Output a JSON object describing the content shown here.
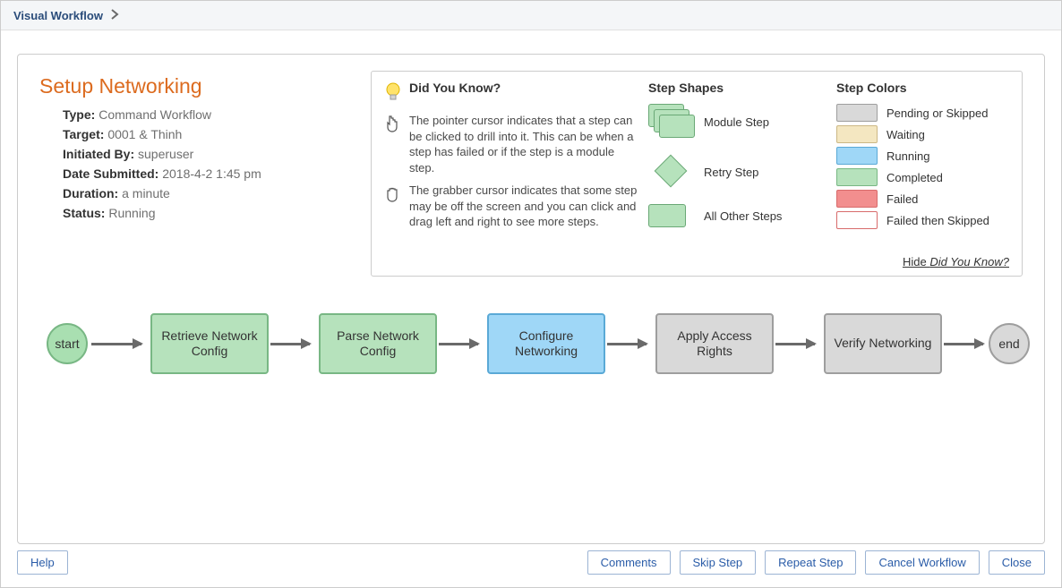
{
  "header": {
    "breadcrumb": "Visual Workflow"
  },
  "workflow": {
    "title": "Setup Networking",
    "meta": {
      "type_label": "Type:",
      "type_value": "Command Workflow",
      "target_label": "Target:",
      "target_value": "0001 & Thinh",
      "initiated_label": "Initiated By:",
      "initiated_value": "superuser",
      "submitted_label": "Date Submitted:",
      "submitted_value": "2018-4-2 1:45 pm",
      "duration_label": "Duration:",
      "duration_value": "a minute",
      "status_label": "Status:",
      "status_value": "Running"
    }
  },
  "didyouknow": {
    "heading": "Did You Know?",
    "tips": [
      "The pointer cursor indicates that a step can be clicked to drill into it. This can be when a step has failed or if the step is a module step.",
      "The grabber cursor indicates that some step may be off the screen and you can click and drag left and right to see more steps."
    ],
    "hide_label_prefix": "Hide ",
    "hide_label_em": "Did You Know?"
  },
  "shapes": {
    "heading": "Step Shapes",
    "items": [
      {
        "label": "Module Step"
      },
      {
        "label": "Retry Step"
      },
      {
        "label": "All Other Steps"
      }
    ]
  },
  "colors": {
    "heading": "Step Colors",
    "items": [
      {
        "label": "Pending or Skipped",
        "hex": "#d9d9d9",
        "border": "#9e9e9e"
      },
      {
        "label": "Waiting",
        "hex": "#f4e7c1",
        "border": "#ccb885"
      },
      {
        "label": "Running",
        "hex": "#9fd7f7",
        "border": "#5aa9d6"
      },
      {
        "label": "Completed",
        "hex": "#b6e2bc",
        "border": "#78b784"
      },
      {
        "label": "Failed",
        "hex": "#f28e8e",
        "border": "#d86b6b"
      },
      {
        "label": "Failed then Skipped",
        "hex": "#ffffff",
        "border": "#d86b6b"
      }
    ]
  },
  "diagram": {
    "start_label": "start",
    "end_label": "end",
    "steps": [
      {
        "label": "Retrieve Network Config",
        "state": "completed"
      },
      {
        "label": "Parse Network Config",
        "state": "completed"
      },
      {
        "label": "Configure Networking",
        "state": "running"
      },
      {
        "label": "Apply Access Rights",
        "state": "pending"
      },
      {
        "label": "Verify Networking",
        "state": "pending"
      }
    ]
  },
  "footer": {
    "help": "Help",
    "comments": "Comments",
    "skip": "Skip Step",
    "repeat": "Repeat Step",
    "cancel": "Cancel Workflow",
    "close": "Close"
  }
}
